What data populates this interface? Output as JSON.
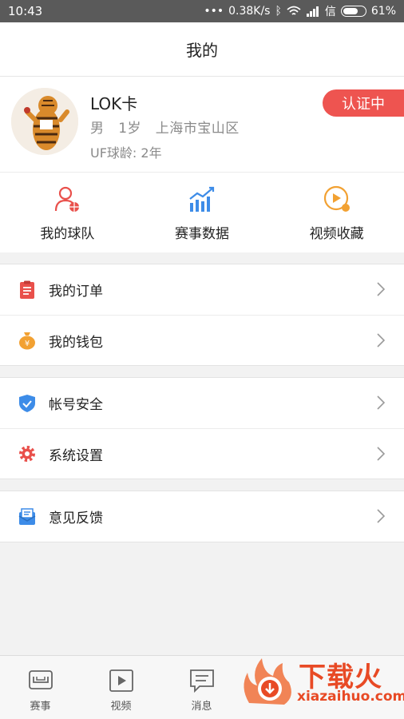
{
  "status_bar": {
    "time": "10:43",
    "net_speed": "0.38K/s",
    "carrier": "信",
    "battery": "61%"
  },
  "header": {
    "title": "我的"
  },
  "profile": {
    "name": "LOK卡",
    "gender": "男",
    "age": "1岁",
    "location": "上海市宝山区",
    "years": "UF球龄: 2年",
    "badge": "认证中"
  },
  "quick_actions": [
    {
      "label": "我的球队",
      "icon": "team-user-icon"
    },
    {
      "label": "赛事数据",
      "icon": "stats-chart-icon"
    },
    {
      "label": "视频收藏",
      "icon": "video-favorite-icon"
    }
  ],
  "menu_groups": [
    [
      {
        "label": "我的订单",
        "icon": "order-clipboard-icon",
        "color": "#e9504b"
      },
      {
        "label": "我的钱包",
        "icon": "wallet-moneybag-icon",
        "color": "#f2a132"
      }
    ],
    [
      {
        "label": "帐号安全",
        "icon": "shield-check-icon",
        "color": "#3d8ce8"
      },
      {
        "label": "系统设置",
        "icon": "gear-icon",
        "color": "#e9504b"
      }
    ],
    [
      {
        "label": "意见反馈",
        "icon": "feedback-mail-icon",
        "color": "#3d8ce8"
      }
    ]
  ],
  "tab_bar": [
    {
      "label": "赛事",
      "icon": "match-icon"
    },
    {
      "label": "视频",
      "icon": "video-play-icon"
    },
    {
      "label": "消息",
      "icon": "message-icon"
    }
  ],
  "watermark": {
    "title": "下载火",
    "subtitle": "xiazaihuo.com"
  },
  "colors": {
    "accent": "#ee5450",
    "text": "#222222",
    "muted": "#8a8a8a",
    "background": "#f2f2f2"
  }
}
